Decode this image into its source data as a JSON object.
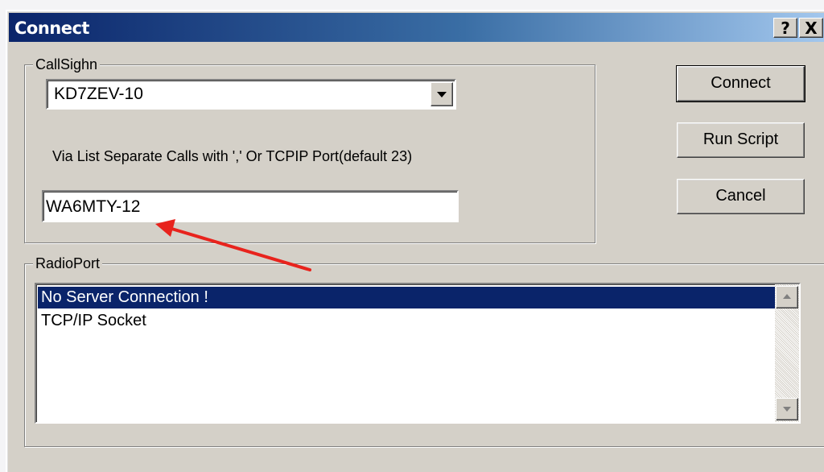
{
  "window": {
    "title": "Connect",
    "help_button": "?",
    "close_button": "X"
  },
  "callsign_group": {
    "legend": "CallSighn",
    "combo_value": "KD7ZEV-10",
    "via_label": "Via List Separate Calls with ',' Or TCPIP Port(default 23)",
    "via_value": "WA6MTY-12"
  },
  "buttons": {
    "connect": "Connect",
    "run_script": "Run Script",
    "cancel": "Cancel"
  },
  "radioport_group": {
    "legend": "RadioPort",
    "items": [
      "No Server Connection !",
      "TCP/IP Socket"
    ],
    "selected_index": 0
  },
  "annotation": {
    "arrow_color": "#e8231d"
  }
}
